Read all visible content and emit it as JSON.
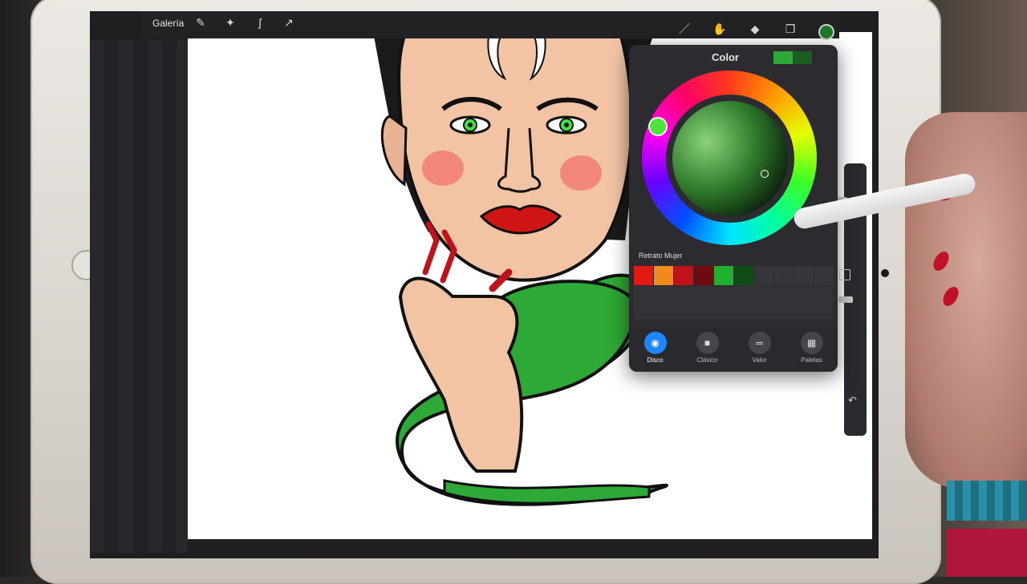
{
  "topbar": {
    "gallery_label": "Galería",
    "icons": [
      "wrench-icon",
      "magic-wand-icon",
      "selection-icon",
      "transform-arrow-icon",
      "brush-icon",
      "smudge-icon",
      "eraser-icon",
      "layers-icon",
      "color-dot-icon"
    ]
  },
  "color_panel": {
    "title": "Color",
    "current_color": "#2ea836",
    "previous_color": "#1a5e22",
    "palette_name": "Retrato Mujer",
    "palette_swatches": [
      "#e21a13",
      "#f08a1e",
      "#c0121a",
      "#6e0b12",
      "#22b12e",
      "#0f4d16"
    ],
    "tabs": [
      {
        "label": "Disco",
        "icon": "disc-icon",
        "active": true
      },
      {
        "label": "Clásico",
        "icon": "square-icon",
        "active": false
      },
      {
        "label": "Valor",
        "icon": "sliders-icon",
        "active": false
      },
      {
        "label": "Paletas",
        "icon": "grid-icon",
        "active": false
      }
    ]
  },
  "colors": {
    "ui_dark": "#2c2c30",
    "accent_blue": "#1e86ff",
    "snake_green": "#2ea836",
    "lip_red": "#d01515",
    "eye_green": "#3ee23a"
  }
}
